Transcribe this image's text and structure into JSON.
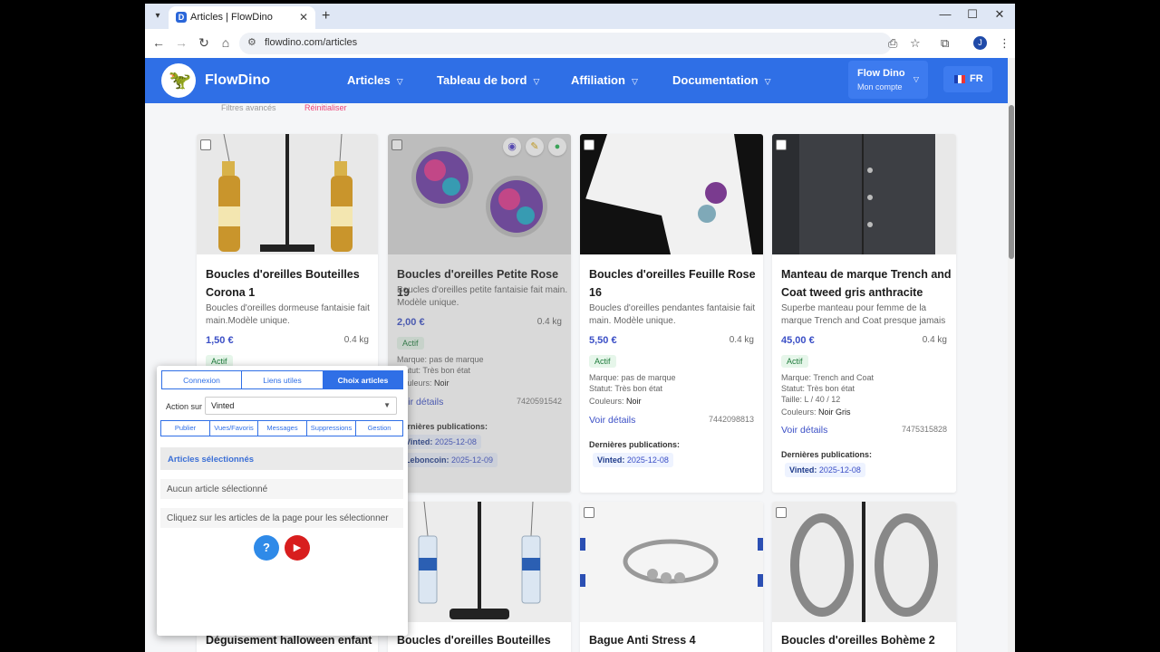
{
  "browser": {
    "tab_title": "Articles | FlowDino",
    "url": "flowdino.com/articles",
    "favicon_letter": "D",
    "account_initial": "J"
  },
  "header": {
    "brand": "FlowDino",
    "nav": [
      "Articles",
      "Tableau de bord",
      "Affiliation",
      "Documentation"
    ],
    "account_name": "Flow Dino",
    "account_sub": "Mon compte",
    "lang": "FR"
  },
  "peek": {
    "filters": "Filtres avancés",
    "reset": "Réinitialiser"
  },
  "cards": [
    {
      "title": "Boucles d'oreilles Bouteilles Corona 1",
      "desc": "Boucles d'oreilles dormeuse fantaisie fait main.Modèle unique.",
      "price": "1,50 €",
      "weight": "0.4 kg",
      "status": "Actif"
    },
    {
      "title": "Boucles d'oreilles Petite Rose 19",
      "desc": "Boucles d'oreilles petite fantaisie fait main. Modèle unique.",
      "price": "2,00 €",
      "weight": "0.4 kg",
      "status": "Actif",
      "marque": "Marque: pas de marque",
      "statut": "Statut: Très bon état",
      "couleurs_label": "Couleurs:",
      "couleurs": "Noir",
      "voir": "Voir détails",
      "id": "7420591542",
      "pub_title": "Dernières publications:",
      "pubs": [
        {
          "site": "Vinted:",
          "date": "2025-12-08"
        },
        {
          "site": "Leboncoin:",
          "date": "2025-12-09"
        }
      ]
    },
    {
      "title": "Boucles d'oreilles Feuille Rose 16",
      "desc": "Boucles d'oreilles pendantes fantaisie fait main. Modèle unique.",
      "price": "5,50 €",
      "weight": "0.4 kg",
      "status": "Actif",
      "marque": "Marque: pas de marque",
      "statut": "Statut: Très bon état",
      "couleurs_label": "Couleurs:",
      "couleurs": "Noir",
      "voir": "Voir détails",
      "id": "7442098813",
      "pub_title": "Dernières publications:",
      "pubs": [
        {
          "site": "Vinted:",
          "date": "2025-12-08"
        }
      ]
    },
    {
      "title": "Manteau de marque Trench and Coat tweed gris anthracite",
      "desc": "Superbe manteau pour femme de la marque Trench and Coat presque jamais",
      "price": "45,00 €",
      "weight": "0.4 kg",
      "status": "Actif",
      "marque": "Marque: Trench and Coat",
      "statut": "Statut: Très bon état",
      "taille": "Taille: L / 40 / 12",
      "couleurs_label": "Couleurs:",
      "couleurs": "Noir Gris",
      "voir": "Voir détails",
      "id": "7475315828",
      "pub_title": "Dernières publications:",
      "pubs": [
        {
          "site": "Vinted:",
          "date": "2025-12-08"
        }
      ]
    }
  ],
  "row2_titles": [
    "Déguisement halloween enfant",
    "Boucles d'oreilles Bouteilles",
    "Bague Anti Stress 4",
    "Boucles d'oreilles Bohème 2"
  ],
  "panel": {
    "tabs": [
      "Connexion",
      "Liens utiles",
      "Choix articles"
    ],
    "action_label": "Action sur",
    "action_value": "Vinted",
    "subtabs": [
      "Publier",
      "Vues/Favoris",
      "Messages",
      "Suppressions",
      "Gestion"
    ],
    "section": "Articles sélectionnés",
    "empty": "Aucun article sélectionné",
    "hint": "Cliquez sur les articles de la page pour les sélectionner"
  },
  "colors": {
    "brand": "#2f6fe6",
    "price": "#3b4fc6",
    "youtube": "#d81e1e",
    "help": "#2f8ae8"
  }
}
